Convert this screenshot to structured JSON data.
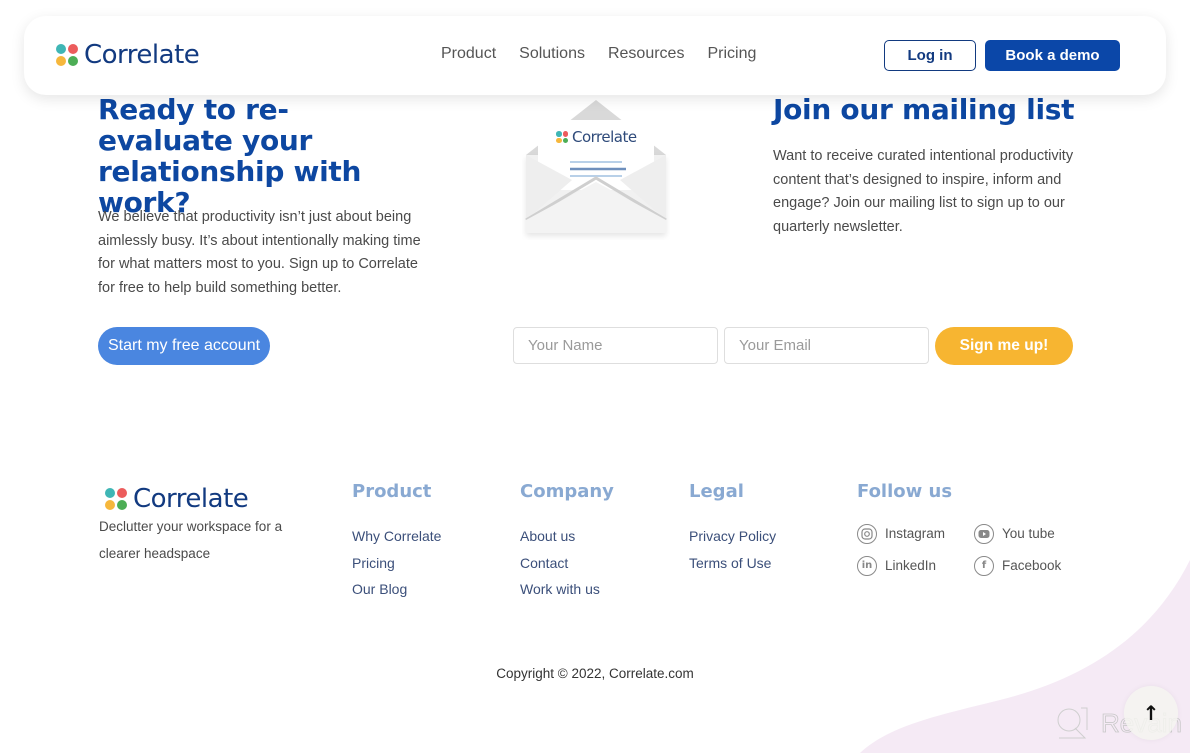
{
  "header": {
    "brand": "Correlate",
    "nav": [
      "Product",
      "Solutions",
      "Resources",
      "Pricing"
    ],
    "login_label": "Log in",
    "demo_label": "Book a demo"
  },
  "cta": {
    "title": "Ready to re-evaluate your relationship with work?",
    "text": "We believe that productivity isn’t just about being aimlessly busy. It’s about intentionally making time for what matters most to you. Sign up to Correlate for free to help build something better.",
    "button_label": "Start my free account"
  },
  "envelope": {
    "brand": "Correlate"
  },
  "mailing": {
    "title": "Join our mailing list",
    "text": "Want to receive curated intentional productivity content that’s designed to inspire, inform and engage? Join our mailing list to sign up to our quarterly newsletter.",
    "name_placeholder": "Your Name",
    "email_placeholder": "Your Email",
    "submit_label": "Sign me up!"
  },
  "footer": {
    "brand": "Correlate",
    "tagline": "Declutter your workspace for a clearer headspace",
    "columns": [
      {
        "title": "Product",
        "links": [
          "Why Correlate",
          "Pricing",
          "Our Blog"
        ]
      },
      {
        "title": "Company",
        "links": [
          "About us",
          "Contact",
          "Work with us"
        ]
      },
      {
        "title": "Legal",
        "links": [
          "Privacy Policy",
          "Terms of Use"
        ]
      }
    ],
    "follow": {
      "title": "Follow us",
      "links": [
        {
          "label": "Instagram",
          "icon": "instagram-icon"
        },
        {
          "label": "You tube",
          "icon": "youtube-icon"
        },
        {
          "label": "LinkedIn",
          "icon": "linkedin-icon"
        },
        {
          "label": "Facebook",
          "icon": "facebook-icon"
        }
      ]
    },
    "copyright": "Copyright © 2022, Correlate.com"
  },
  "watermark": "Revain",
  "scroll_top_icon": "arrow-up-icon",
  "colors": {
    "brand_dark": "#0d47a1",
    "primary_button": "#0b47a8",
    "start_button": "#4a86e0",
    "signup_button": "#f7b531",
    "footer_heading": "#89a9d2",
    "wave": "#f5eaf5"
  }
}
